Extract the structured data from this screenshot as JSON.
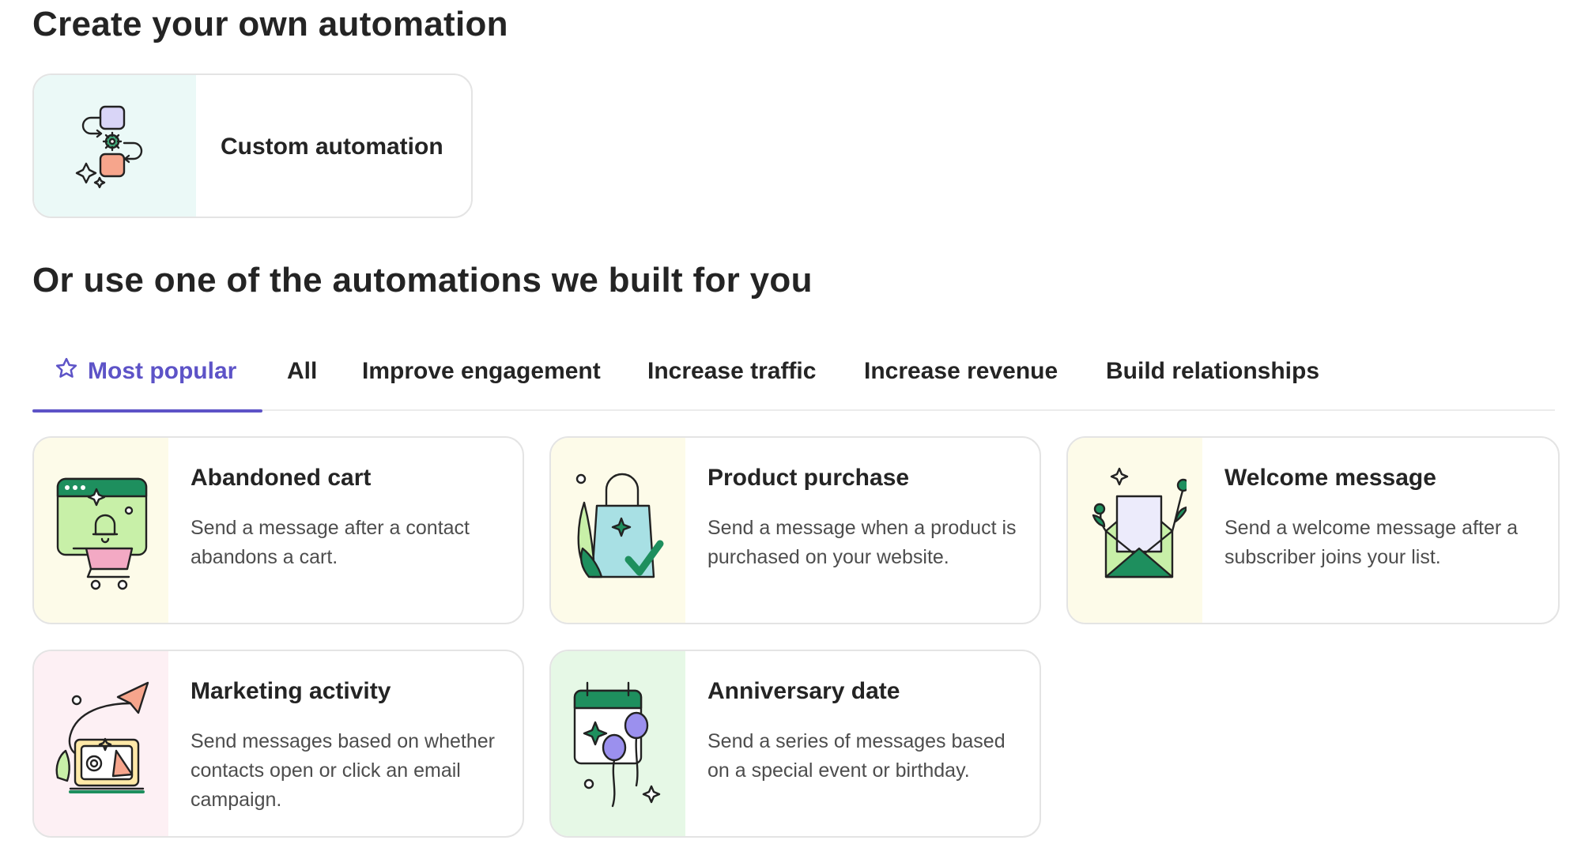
{
  "custom_section": {
    "heading": "Create your own automation",
    "card_label": "Custom automation"
  },
  "prebuilt_section": {
    "heading": "Or use one of the automations we built for you"
  },
  "tabs": [
    {
      "label": "Most popular",
      "active": true,
      "icon": "star-icon"
    },
    {
      "label": "All",
      "active": false
    },
    {
      "label": "Improve engagement",
      "active": false
    },
    {
      "label": "Increase traffic",
      "active": false
    },
    {
      "label": "Increase revenue",
      "active": false
    },
    {
      "label": "Build relationships",
      "active": false
    }
  ],
  "cards": [
    {
      "title": "Abandoned cart",
      "description": "Send a message after a contact abandons a cart.",
      "icon": "shopping-cart-icon"
    },
    {
      "title": "Product purchase",
      "description": "Send a message when a product is purchased on your website.",
      "icon": "shopping-bag-icon"
    },
    {
      "title": "Welcome message",
      "description": "Send a welcome message after a subscriber joins your list.",
      "icon": "envelope-icon"
    },
    {
      "title": "Marketing activity",
      "description": "Send messages based on whether contacts open or click an email campaign.",
      "icon": "megaphone-icon"
    },
    {
      "title": "Anniversary date",
      "description": "Send a series of messages based on a special event or birthday.",
      "icon": "calendar-balloons-icon"
    }
  ],
  "colors": {
    "accent": "#5d53c7",
    "brand_green": "#1e8f5e",
    "text": "#242424",
    "muted_text": "#4d4d4d",
    "border": "#e4e4e4"
  }
}
